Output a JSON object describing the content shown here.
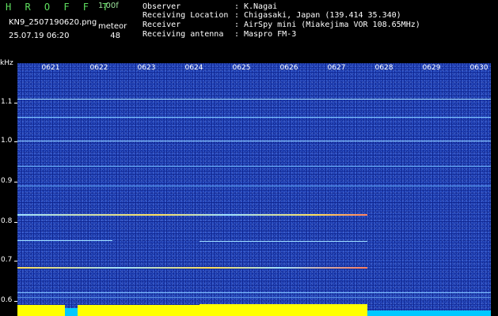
{
  "header": {
    "app_title": "H R O F F T",
    "version": "1.00f",
    "filename": "KN9_2507190620.png",
    "datetime": "25.07.19 06:20",
    "meteor_label": "meteor",
    "meteor_count": "48"
  },
  "info": [
    {
      "label": "Observer",
      "value": "K.Nagai"
    },
    {
      "label": "Receiving Location",
      "value": "Chigasaki, Japan (139.414 35.340)"
    },
    {
      "label": "Receiver",
      "value": "AirSpy mini (Miakejima VOR 108.65MHz)"
    },
    {
      "label": "Receiving antenna",
      "value": "Maspro FM-3"
    }
  ],
  "axis": {
    "y_unit": "kHz",
    "y_ticks": [
      "1.1",
      "1.0",
      "0.9",
      "0.8",
      "0.7",
      "0.6"
    ],
    "x_ticks": [
      "0621",
      "0622",
      "0623",
      "0624",
      "0625",
      "0626",
      "0627",
      "0628",
      "0629",
      "0630"
    ]
  },
  "colors": {
    "background": "#000000",
    "spectrogram": "#102896",
    "title_green": "#5fe05f",
    "trace_cyan": "#7fd8ff",
    "trace_yellow": "#ffe05a",
    "bar_yellow": "#ffff00",
    "bar_cyan": "#00c8ff"
  }
}
